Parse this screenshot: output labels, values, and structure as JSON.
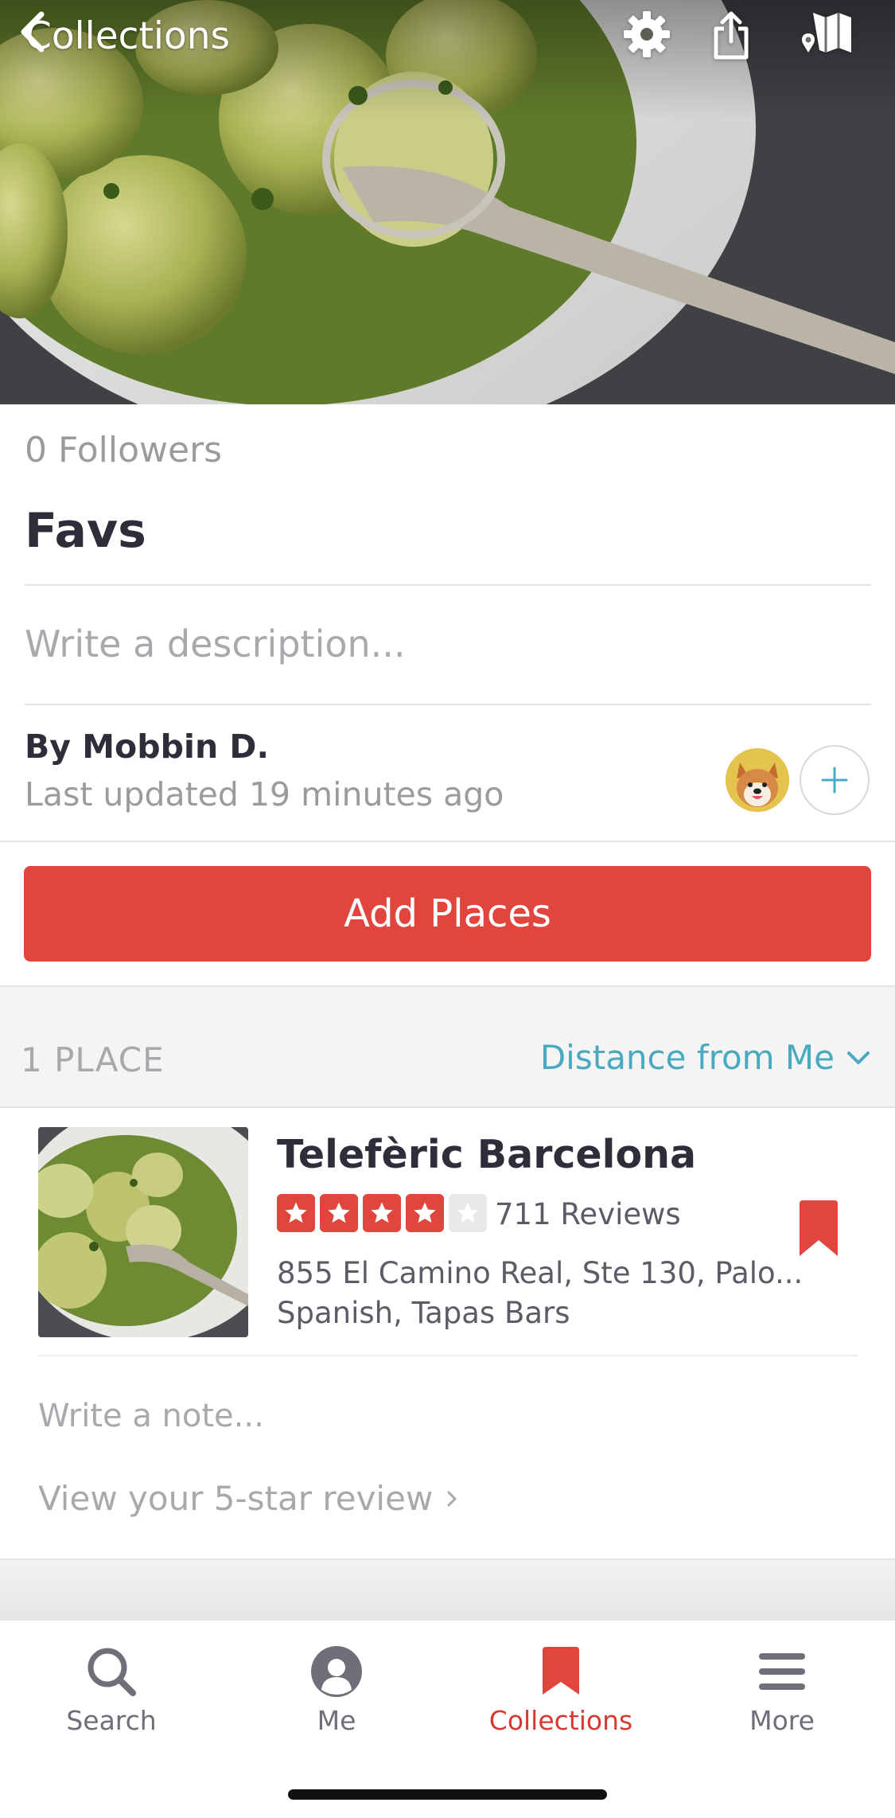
{
  "nav": {
    "back_label": "Collections",
    "icons": [
      "settings-gear-icon",
      "share-icon",
      "map-icon"
    ]
  },
  "collection": {
    "followers": "0 Followers",
    "title": "Favs",
    "description_placeholder": "Write a description...",
    "author": "By Mobbin D.",
    "last_updated": "Last updated 19 minutes ago",
    "add_places_label": "Add Places"
  },
  "list": {
    "count_label": "1 PLACE",
    "sort_label": "Distance from Me",
    "places": [
      {
        "name": "Telefèric Barcelona",
        "rating": 4,
        "max_rating": 5,
        "reviews": "711 Reviews",
        "address": "855 El Camino Real, Ste 130, Palo...",
        "categories": "Spanish, Tapas Bars",
        "note_placeholder": "Write a note...",
        "review_link": "View your 5-star review"
      }
    ]
  },
  "tabs": [
    {
      "label": "Search",
      "icon": "search-icon"
    },
    {
      "label": "Me",
      "icon": "profile-icon"
    },
    {
      "label": "Collections",
      "icon": "bookmark-icon",
      "active": true
    },
    {
      "label": "More",
      "icon": "menu-icon"
    }
  ],
  "colors": {
    "brand_red": "#e0463d",
    "link_teal": "#48a9c0",
    "active_tab": "#d8382f"
  }
}
